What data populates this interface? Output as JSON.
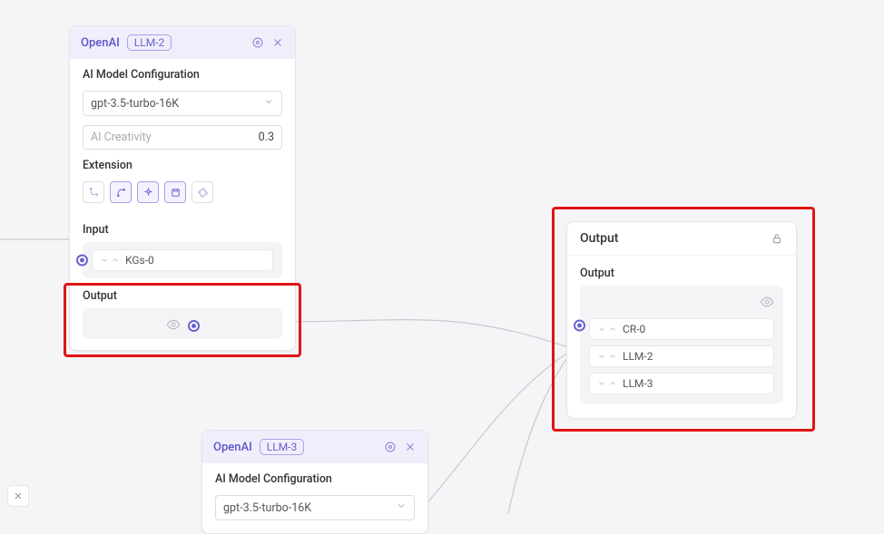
{
  "node_llm2": {
    "provider": "OpenAI",
    "tag": "LLM-2",
    "config_label": "AI Model Configuration",
    "model": "gpt-3.5-turbo-16K",
    "creativity_label": "AI Creativity",
    "creativity_value": "0.3",
    "extension_label": "Extension",
    "input_label": "Input",
    "input_item": "KGs-0",
    "output_label": "Output"
  },
  "node_out": {
    "title": "Output",
    "section_label": "Output",
    "items": [
      "CR-0",
      "LLM-2",
      "LLM-3"
    ]
  },
  "node_llm3": {
    "provider": "OpenAI",
    "tag": "LLM-3",
    "config_label": "AI Model Configuration",
    "model": "gpt-3.5-turbo-16K"
  }
}
